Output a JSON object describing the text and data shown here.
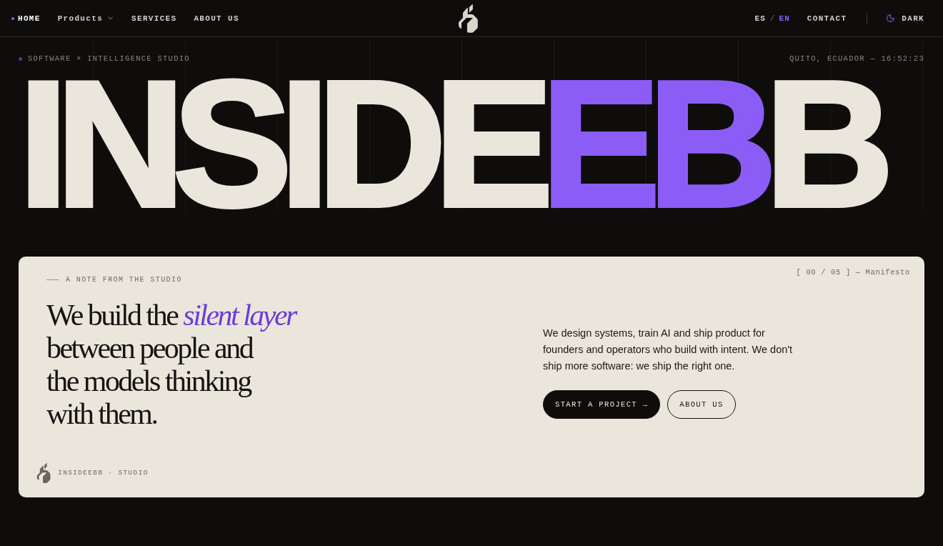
{
  "nav": {
    "items": [
      {
        "label": "HOME",
        "selected": true,
        "has_menu": false
      },
      {
        "label": "Products",
        "selected": false,
        "has_menu": true
      },
      {
        "label": "SERVICES",
        "selected": false,
        "has_menu": false
      },
      {
        "label": "ABOUT US",
        "selected": false,
        "has_menu": false
      }
    ],
    "languages": [
      {
        "label": "ES",
        "selected": false
      },
      {
        "label": "EN",
        "selected": true
      }
    ],
    "language_separator": "/",
    "contact": "CONTACT",
    "theme_toggle": "DARK"
  },
  "hero": {
    "tagline": "SOFTWARE × INTELLIGENCE STUDIO",
    "location": "QUITO, ECUADOR — 16:52:23",
    "wordmark": [
      {
        "text": "INSIDE",
        "accent": false
      },
      {
        "text": "EB",
        "accent": true
      },
      {
        "text": "B",
        "accent": false
      }
    ]
  },
  "manifesto": {
    "eyebrow": "A NOTE FROM THE STUDIO",
    "counter": "[ 00 / 05 ] — Manifesto",
    "heading_lines": [
      "We build the *silent layer*",
      "between people and",
      "the models thinking",
      "with them."
    ],
    "body": "We design systems, train AI and ship product for founders and operators who build with intent. We don't ship more software: we ship the right one.",
    "buttons": [
      {
        "label": "START A PROJECT →",
        "kind": "primary"
      },
      {
        "label": "ABOUT US",
        "kind": "secondary"
      }
    ],
    "footer": "INSIDEEBB · STUDIO"
  }
}
